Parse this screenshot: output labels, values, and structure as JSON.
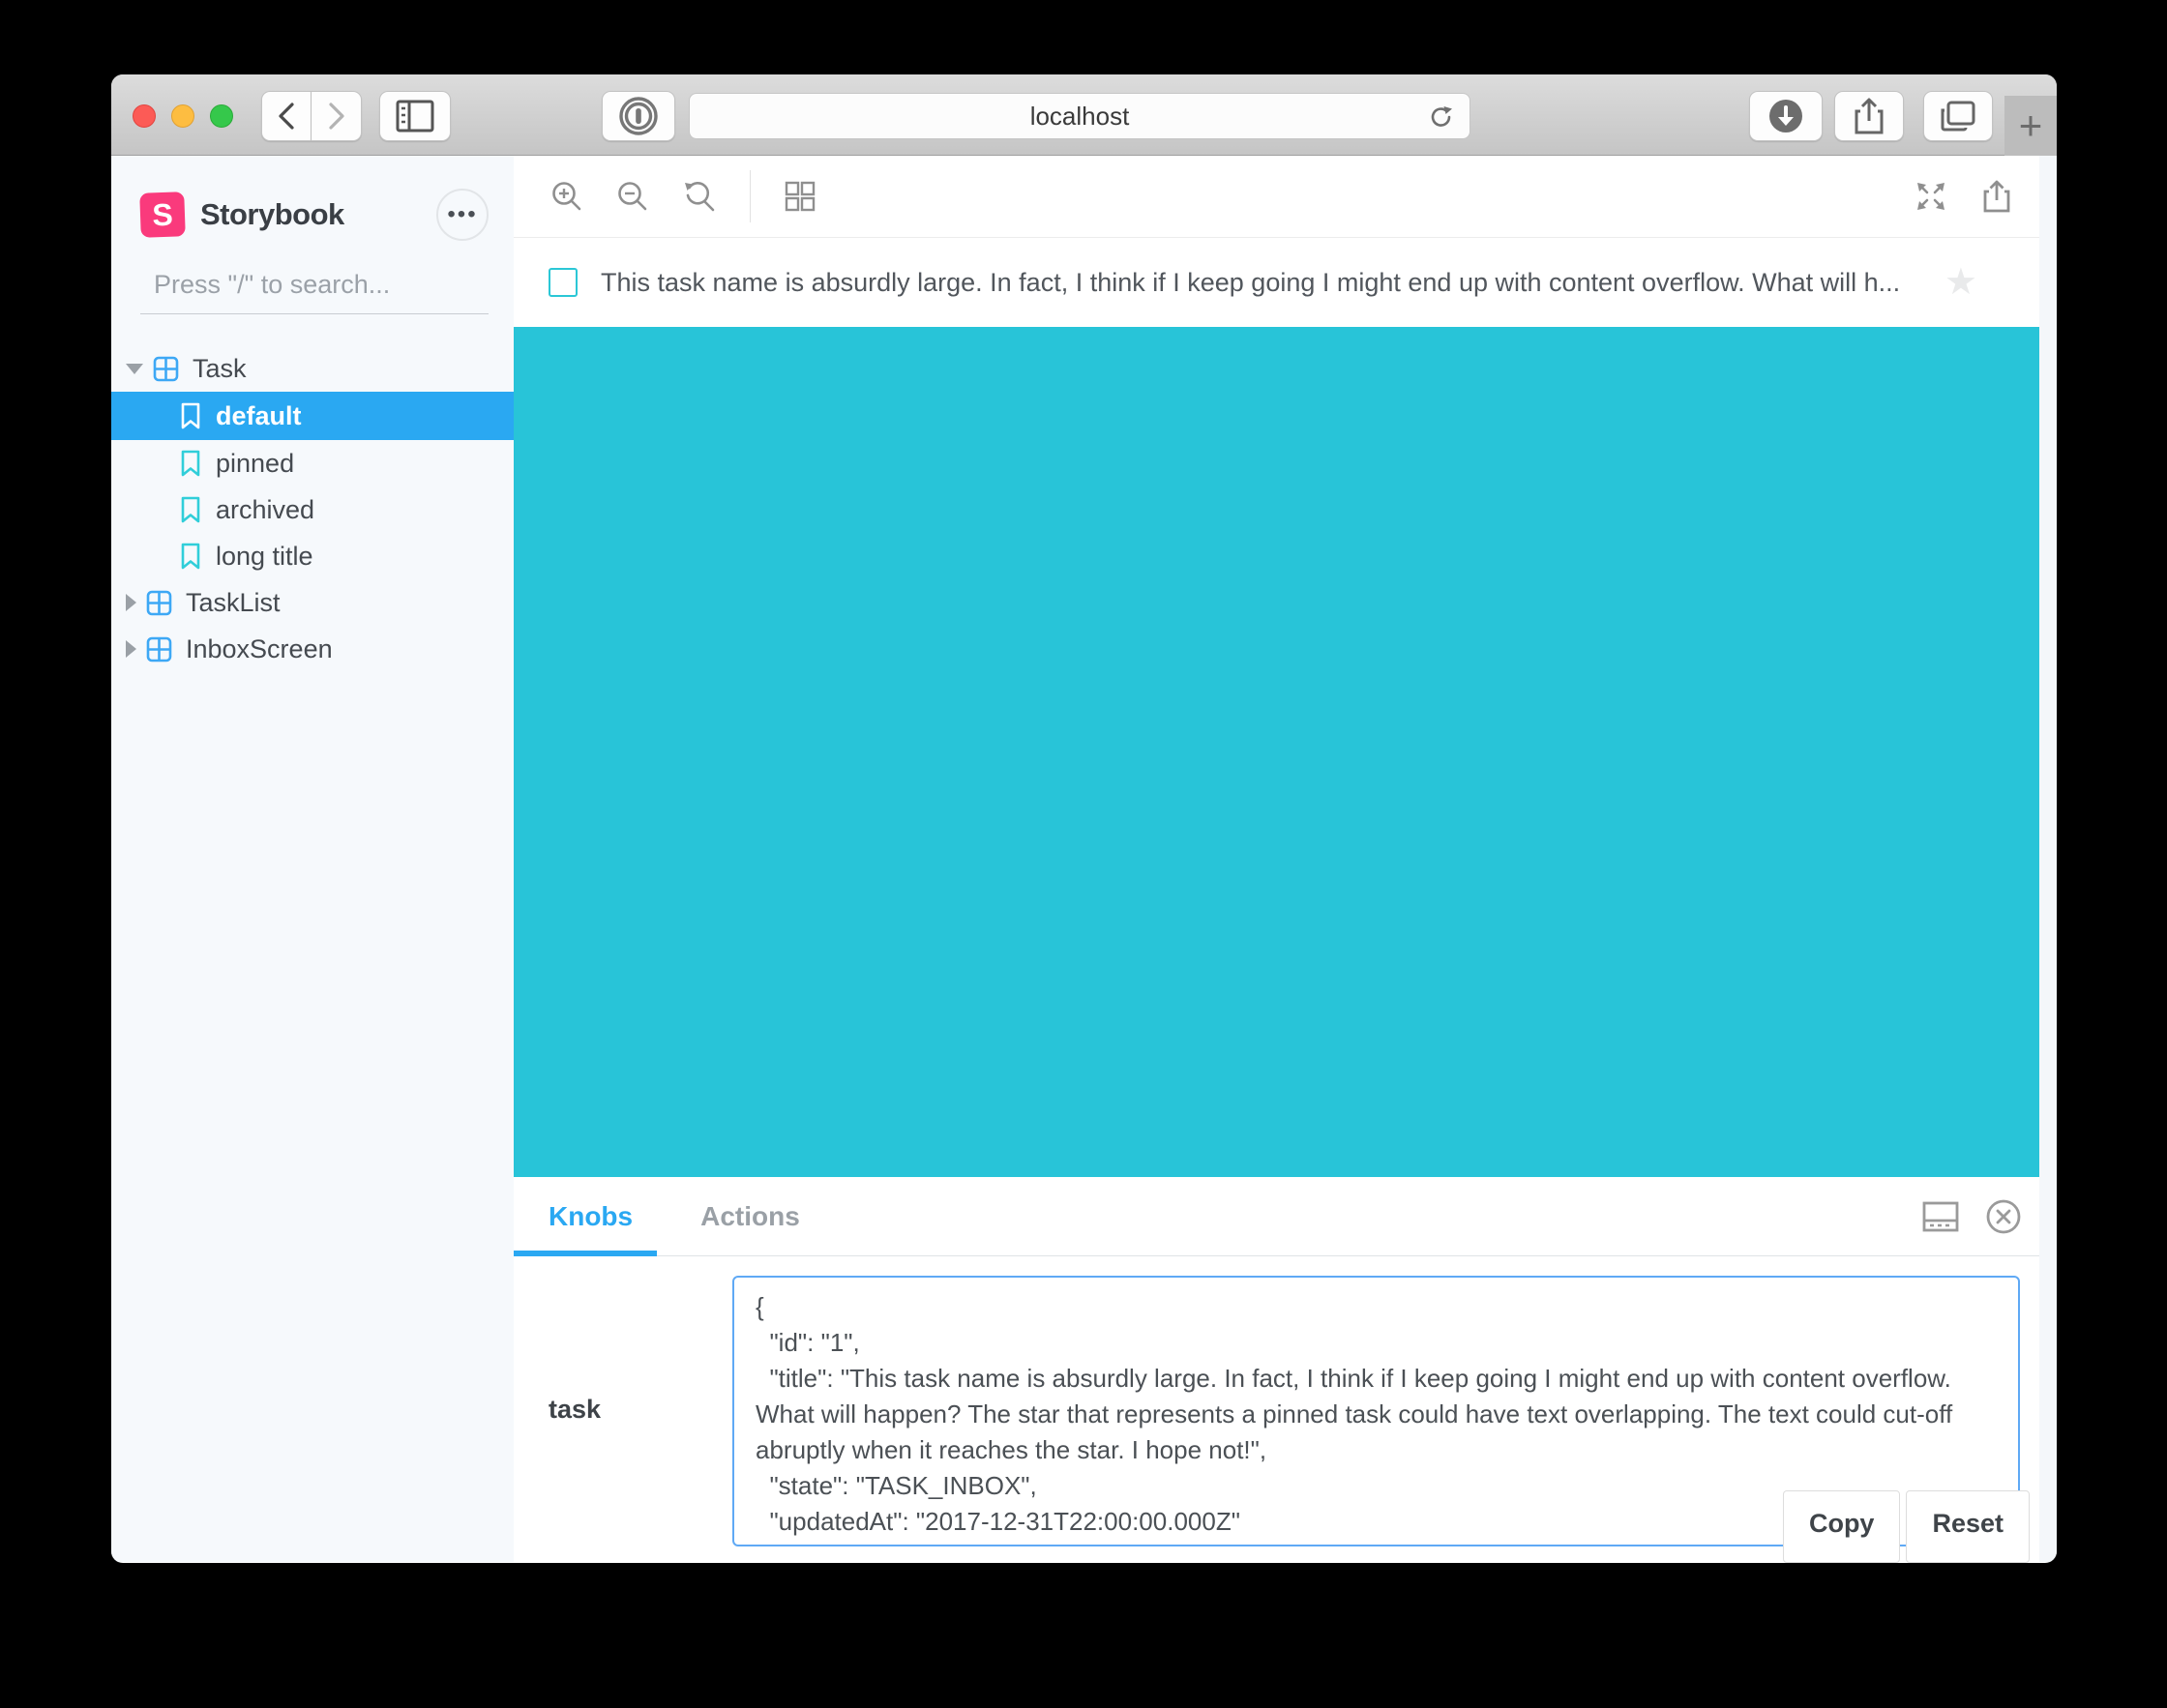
{
  "browser": {
    "url": "localhost",
    "new_tab_glyph": "+"
  },
  "icons": {
    "menu_dots": "•••",
    "star": "★"
  },
  "sidebar": {
    "brand": "Storybook",
    "logo_letter": "S",
    "brand_color": "#fa3a7c",
    "search_placeholder": "Press \"/\" to search...",
    "tree": [
      {
        "label": "Task",
        "type": "component",
        "expanded": true,
        "stories": [
          {
            "label": "default",
            "selected": true
          },
          {
            "label": "pinned",
            "selected": false
          },
          {
            "label": "archived",
            "selected": false
          },
          {
            "label": "long title",
            "selected": false
          }
        ]
      },
      {
        "label": "TaskList",
        "type": "component",
        "expanded": false
      },
      {
        "label": "InboxScreen",
        "type": "component",
        "expanded": false
      }
    ],
    "selected_color": "#2aa8f2"
  },
  "preview": {
    "task_title": "This task name is absurdly large. In fact, I think if I keep going I might end up with content overflow. What will h...",
    "canvas_color": "#28c4d8",
    "checkbox_checked": false
  },
  "panel": {
    "tabs": [
      {
        "label": "Knobs",
        "active": true
      },
      {
        "label": "Actions",
        "active": false
      }
    ],
    "knob": {
      "name": "task",
      "value": "{\n  \"id\": \"1\",\n  \"title\": \"This task name is absurdly large. In fact, I think if I keep going I might end up with content overflow. What will happen? The star that represents a pinned task could have text overlapping. The text could cut-off abruptly when it reaches the star. I hope not!\",\n  \"state\": \"TASK_INBOX\",\n  \"updatedAt\": \"2017-12-31T22:00:00.000Z\""
    },
    "copy_label": "Copy",
    "reset_label": "Reset",
    "accent_color": "#2aa8f2"
  }
}
